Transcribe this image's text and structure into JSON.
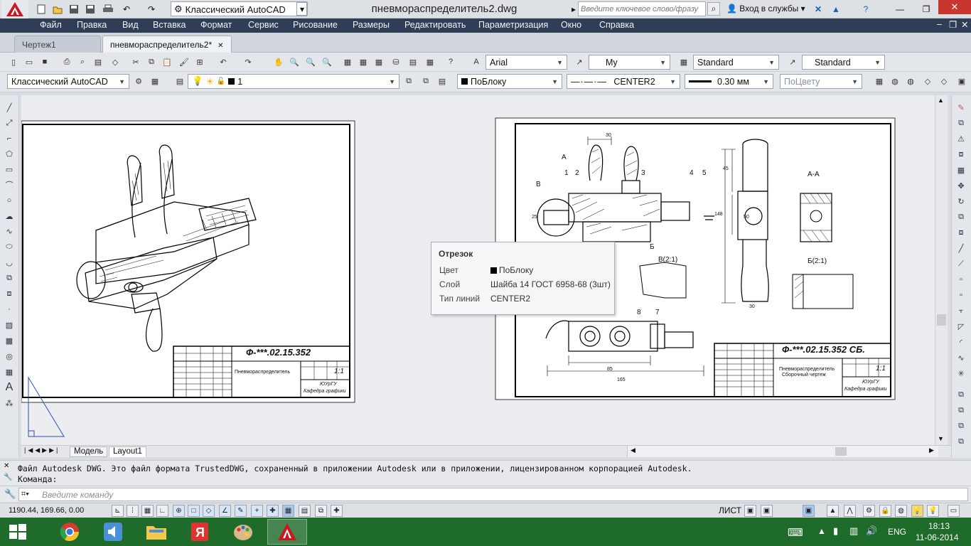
{
  "window": {
    "title": "пневмораспределитель2.dwg",
    "workspace": "Классический AutoCAD",
    "search_placeholder": "Введите ключевое слово/фразу",
    "signin": "Вход в службы"
  },
  "menu": [
    "Файл",
    "Правка",
    "Вид",
    "Вставка",
    "Формат",
    "Сервис",
    "Рисование",
    "Размеры",
    "Редактировать",
    "Параметризация",
    "Окно",
    "Справка"
  ],
  "doc_tabs": [
    {
      "label": "Чертеж1"
    },
    {
      "label": "пневмораспределитель2*"
    }
  ],
  "toolbar1": {
    "text_font": "Arial",
    "dim_style": "My",
    "table_style": "Standard",
    "mleader_style": "Standard"
  },
  "toolbar2": {
    "workspace": "Классический AutoCAD",
    "layer": "1",
    "color": "ПоБлоку",
    "linetype": "CENTER2",
    "lineweight": "0.30 мм",
    "plotstyle": "ПоЦвету"
  },
  "tooltip": {
    "title": "Отрезок",
    "rows": [
      {
        "label": "Цвет",
        "value": "ПоБлоку"
      },
      {
        "label": "Слой",
        "value": "Шайба 14 ГОСТ 6958-68 (3шт)"
      },
      {
        "label": "Тип линий",
        "value": "CENTER2"
      }
    ]
  },
  "drawing_left": {
    "code": "Ф-***.02.15.352",
    "name": "Пневмораспределитель",
    "scale": "1:1",
    "org1": "ЮУрГУ",
    "org2": "Кафедра графики"
  },
  "drawing_right": {
    "code": "Ф-***.02.15.352 СБ.",
    "name": "Пневмораспределитель",
    "name2": "Сборочный чертеж",
    "scale": "1:1",
    "org1": "ЮУрГУ",
    "org2": "Кафедра графики",
    "section_aa": "А-А",
    "view_b": "В(2:1)",
    "view_b2": "Б(2:1)",
    "dims": [
      "30",
      "45",
      "50",
      "148",
      "30",
      "85",
      "165",
      "25"
    ],
    "labels": [
      "1",
      "2",
      "3",
      "4",
      "5",
      "7",
      "8",
      "А",
      "В",
      "Б"
    ]
  },
  "layout_tabs": [
    "Модель",
    "Layout1"
  ],
  "command": {
    "history1": "Файл Autodesk DWG. Это файл формата TrustedDWG, сохраненный в приложении Autodesk или в приложении, лицензированном корпорацией Autodesk.",
    "history2": "Команда:",
    "placeholder": "Введите команду"
  },
  "status": {
    "coords": "1190.44, 169.66, 0.00",
    "space": "ЛИСТ"
  },
  "taskbar": {
    "lang": "ENG",
    "time": "18:13",
    "date": "11-06-2014"
  },
  "colors": {
    "menubar": "#2f3d56",
    "taskbar": "#1e6b2a",
    "canvas": "#ebedf0",
    "autocad_red": "#c8171d"
  }
}
